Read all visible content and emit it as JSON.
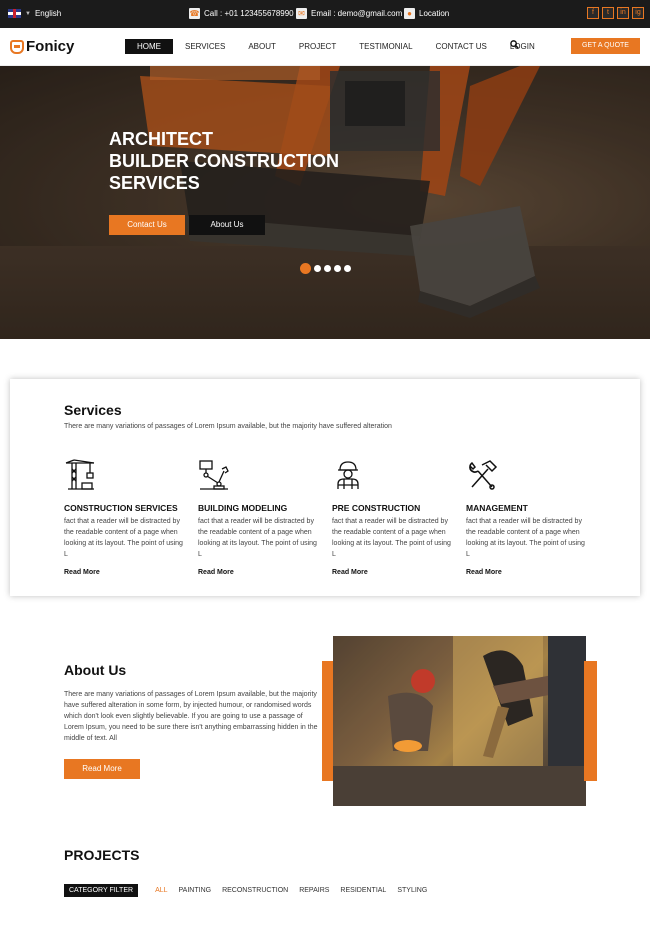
{
  "topbar": {
    "language": "English",
    "call": "Call : +01 123455678990",
    "email": "Email : demo@gmail.com",
    "location": "Location",
    "social": [
      "f",
      "t",
      "in",
      "ig"
    ]
  },
  "nav": {
    "logo": "Fonicy",
    "items": [
      "HOME",
      "SERVICES",
      "ABOUT",
      "PROJECT",
      "TESTIMONIAL",
      "CONTACT US",
      "LOGIN"
    ],
    "quote": "GET A QUOTE"
  },
  "hero": {
    "line1": "ARCHITECT",
    "line2": "BUILDER CONSTRUCTION",
    "line3": "SERVICES",
    "btn_contact": "Contact Us",
    "btn_about": "About Us",
    "slides": 5,
    "active_slide": 1
  },
  "services": {
    "title": "Services",
    "subtitle": "There are many variations of passages of Lorem Ipsum available, but the majority have suffered alteration",
    "items": [
      {
        "title": "CONSTRUCTION SERVICES",
        "text": "fact that a reader will be distracted by the readable content of a page when looking at its layout. The point of using L",
        "link": "Read More",
        "icon": "crane-icon"
      },
      {
        "title": "BUILDING MODELING",
        "text": "fact that a reader will be distracted by the readable content of a page when looking at its layout. The point of using L",
        "link": "Read More",
        "icon": "robot-arm-icon"
      },
      {
        "title": "PRE CONSTRUCTION",
        "text": "fact that a reader will be distracted by the readable content of a page when looking at its layout. The point of using L",
        "link": "Read More",
        "icon": "worker-icon"
      },
      {
        "title": "MANAGEMENT",
        "text": "fact that a reader will be distracted by the readable content of a page when looking at its layout. The point of using L",
        "link": "Read More",
        "icon": "hammer-wrench-icon"
      }
    ]
  },
  "about": {
    "title": "About Us",
    "text": "There are many variations of passages of Lorem Ipsum available, but the majority have suffered alteration in some form, by injected humour, or randomised words which don't look even slightly believable. If you are going to use a passage of Lorem Ipsum, you need to be sure there isn't anything embarrassing hidden in the middle of text. All",
    "btn": "Read More"
  },
  "projects": {
    "title": "PROJECTS",
    "category_label": "CATEGORY FILTER",
    "filters": [
      "ALL",
      "PAINTING",
      "RECONSTRUCTION",
      "REPAIRS",
      "RESIDENTIAL",
      "STYLING"
    ],
    "selected": "ALL"
  },
  "colors": {
    "accent": "#e87722",
    "dark": "#1b1b1b"
  }
}
